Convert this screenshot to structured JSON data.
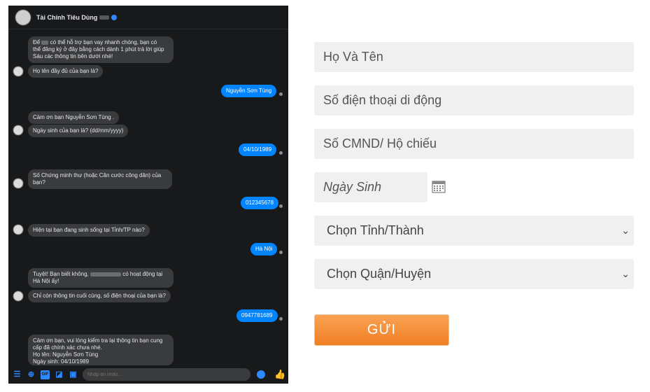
{
  "chat": {
    "title": "Tài Chính Tiêu Dùng",
    "messages_in": [
      {
        "l1": "Để",
        "l1b": "có thể hỗ trợ bạn vay nhanh chóng, bạn có",
        "l2": "thể đăng ký ở đây bằng cách dành 1 phút trả lời giúp",
        "l3": "Sáu các thông tin bên dưới nhé!"
      },
      {
        "text": "Họ tên đầy đủ của bạn là?"
      },
      {
        "text": "Cảm ơn bạn Nguyễn Sơn Tùng ."
      },
      {
        "text": "Ngày sinh của bạn là? (dd/mm/yyyy)"
      },
      {
        "l1": "Số Chứng minh thư (hoặc Căn cước công dân) của",
        "l2": "bạn?"
      },
      {
        "text": "Hiện tại bạn đang sinh sống tại Tỉnh/TP nào?"
      },
      {
        "l1a": "Tuyệt! Bạn biết không,",
        "l1b": "có hoạt động tại",
        "l2": "Hà Nội ấy!"
      },
      {
        "text": "Chỉ còn thông tin cuối cùng, số điện thoại của bạn là?"
      },
      {
        "l1": "Cảm ơn bạn, vui lòng kiểm tra lại thông tin bạn cung",
        "l2": "cấp đã chính xác chưa nhé.",
        "l3": "Họ tên: Nguyễn Sơn Tùng",
        "l4": "Ngày sinh: 04/10/1989"
      }
    ],
    "messages_out": [
      "Nguyễn Sơn Tùng",
      "04/10/1989",
      "012345678",
      "Hà Nội",
      "0947781689"
    ],
    "composer_placeholder": "Nhập tin nhắn...",
    "gif_label": "GIF"
  },
  "form": {
    "name_placeholder": "Họ Và Tên",
    "phone_placeholder": "Số điện thoại di động",
    "id_placeholder": "Số CMND/ Hộ chiếu",
    "dob_placeholder": "Ngày Sinh",
    "province_select": "Chọn Tỉnh/Thành",
    "district_select": "Chọn Quận/Huyện",
    "submit_label": "GỬI"
  },
  "colors": {
    "accent": "#f39240",
    "messenger_blue": "#0084ff",
    "chat_bg": "#18191a"
  }
}
